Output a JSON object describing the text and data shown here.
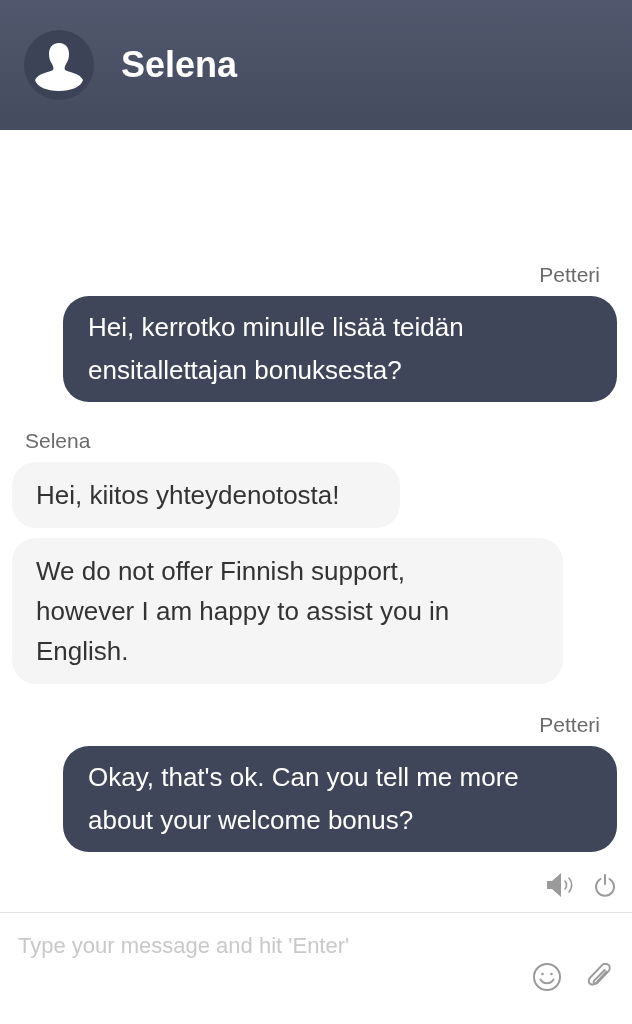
{
  "header": {
    "title": "Selena"
  },
  "messages": [
    {
      "sender": "Petteri",
      "kind": "outgoing",
      "bubbles": [
        "Hei, kerrotko minulle lisää teidän ensitallettajan bonuksesta?"
      ]
    },
    {
      "sender": "Selena",
      "kind": "incoming",
      "bubbles": [
        "Hei, kiitos yhteydenotosta!",
        "We do not offer Finnish support, however I am happy to assist you in English."
      ]
    },
    {
      "sender": "Petteri",
      "kind": "outgoing",
      "bubbles": [
        "Okay, that's ok. Can you tell me more about your welcome bonus?"
      ]
    }
  ],
  "controls": {
    "sound_muted": false
  },
  "composer": {
    "placeholder": "Type your message and hit 'Enter'"
  }
}
